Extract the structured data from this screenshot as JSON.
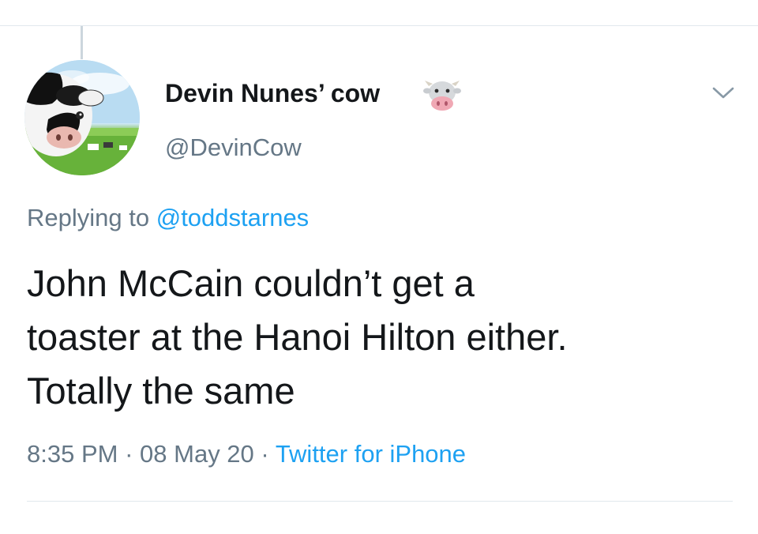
{
  "tweet": {
    "author": {
      "display_name": "Devin Nunes’ cow",
      "badge_icon": "cow-face-icon",
      "handle": "@DevinCow"
    },
    "reply": {
      "prefix": "Replying to",
      "handle": "@toddstarnes"
    },
    "text_lines": [
      "John McCain couldn’t get a",
      "toaster at the Hanoi Hilton either.",
      "Totally the same"
    ],
    "meta": {
      "time": "8:35 PM",
      "separator": "·",
      "date": "08 May 20",
      "source": "Twitter for iPhone"
    }
  },
  "icons": {
    "menu": "chevron-down-icon"
  },
  "colors": {
    "text": "#14171a",
    "secondary": "#657786",
    "link": "#1da1f2",
    "divider": "#e1e8ed"
  }
}
